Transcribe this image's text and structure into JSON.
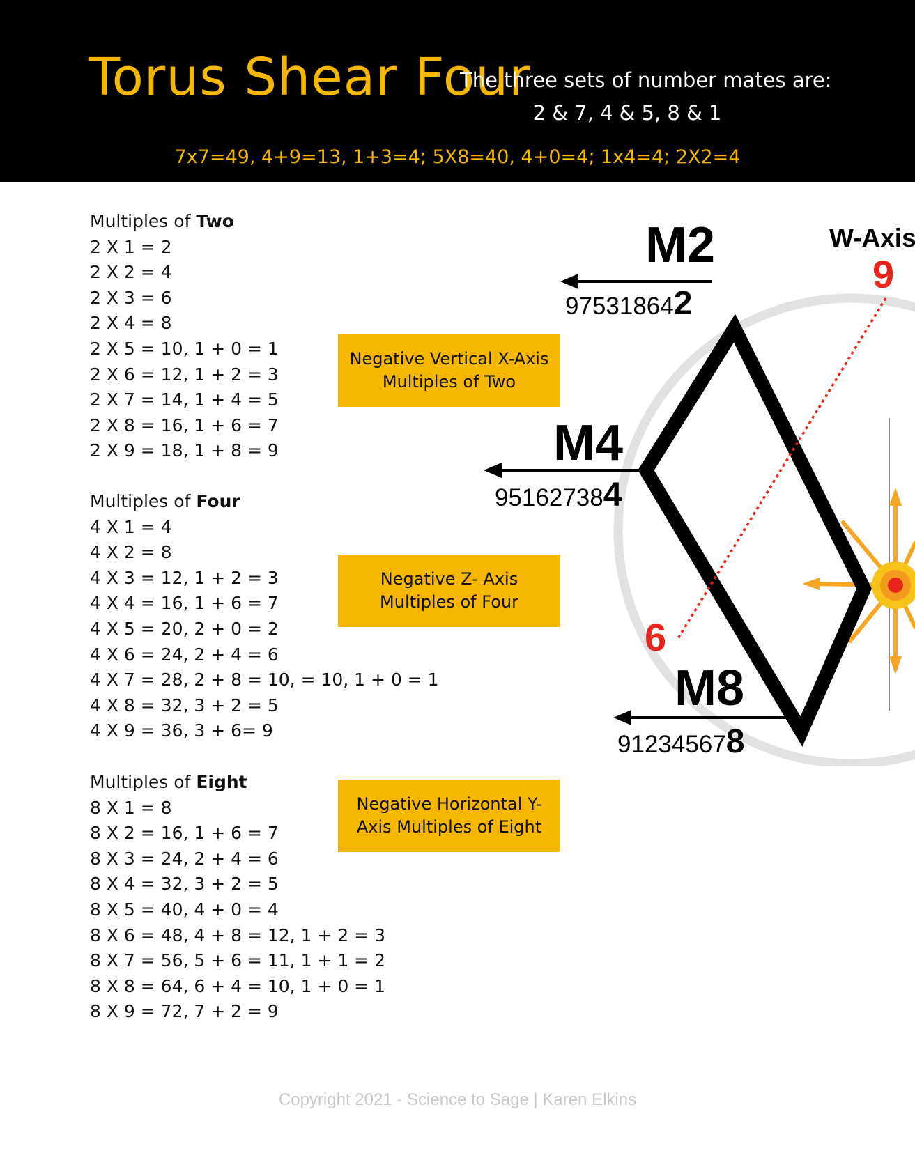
{
  "header": {
    "title": "Torus Shear Four",
    "mates_line1": "The three sets of number mates are:",
    "mates_line2": "2 & 7,  4 & 5, 8 & 1",
    "equation": "7x7=49, 4+9=13, 1+3=4; 5X8=40, 4+0=4; 1x4=4; 2X2=4"
  },
  "multiples": [
    {
      "prefix": "Multiples of ",
      "name": "Two",
      "rows": [
        "2 X 1 = 2",
        "2 X 2 = 4",
        "2 X 3 = 6",
        "2 X 4 = 8",
        "2 X 5 = 10,  1 + 0 = 1",
        "2 X 6 = 12, 1 + 2 = 3",
        "2 X 7 = 14, 1 + 4 = 5",
        "2 X 8 = 16, 1 + 6 = 7",
        "2 X 9 = 18, 1 + 8 = 9"
      ]
    },
    {
      "prefix": "Multiples of ",
      "name": "Four",
      "rows": [
        "4 X 1 = 4",
        "4 X 2 = 8",
        "4 X 3 = 12, 1 + 2 = 3",
        "4 X 4 = 16, 1 + 6 = 7",
        "4 X 5 = 20, 2 + 0 = 2",
        "4 X 6 = 24, 2 + 4 = 6",
        "4 X 7 = 28, 2 + 8 = 10, = 10, 1 + 0  = 1",
        "4 X 8 = 32, 3 + 2 = 5",
        "4 X 9 = 36, 3 + 6= 9"
      ]
    },
    {
      "prefix": "Multiples of ",
      "name": "Eight",
      "rows": [
        "8 X 1 = 8",
        "8 X 2 = 16, 1 + 6 = 7",
        "8 X 3 = 24, 2 + 4 = 6",
        "8 X 4 = 32, 3 + 2 = 5",
        "8 X 5 = 40, 4 + 0 = 4",
        "8 X 6 = 48, 4 + 8 = 12, 1 + 2 = 3",
        "8 X 7 = 56, 5 + 6 = 11,  1 + 1 = 2",
        "8 X 8 = 64, 6 + 4 = 10, 1 + 0 = 1",
        "8 X 9 = 72, 7 + 2 = 9"
      ]
    }
  ],
  "labels": {
    "two": "Negative Vertical X-Axis Multiples of Two",
    "four": "Negative Z- Axis Multiples of Four",
    "eight": "Negative Horizontal Y-Axis Multiples of Eight"
  },
  "diagram": {
    "m2": "M2",
    "m2_seq": "97531864",
    "m2_digit": "2",
    "m4": "M4",
    "m4_seq": "95162738",
    "m4_digit": "4",
    "m8": "M8",
    "m8_seq": "91234567",
    "m8_digit": "8",
    "w_axis": "W-Axis",
    "nine": "9",
    "six": "6"
  },
  "colors": {
    "accent": "#F5B700",
    "red": "#E8251B",
    "black": "#000000"
  },
  "footer": "Copyright 2021 - Science to Sage | Karen Elkins"
}
